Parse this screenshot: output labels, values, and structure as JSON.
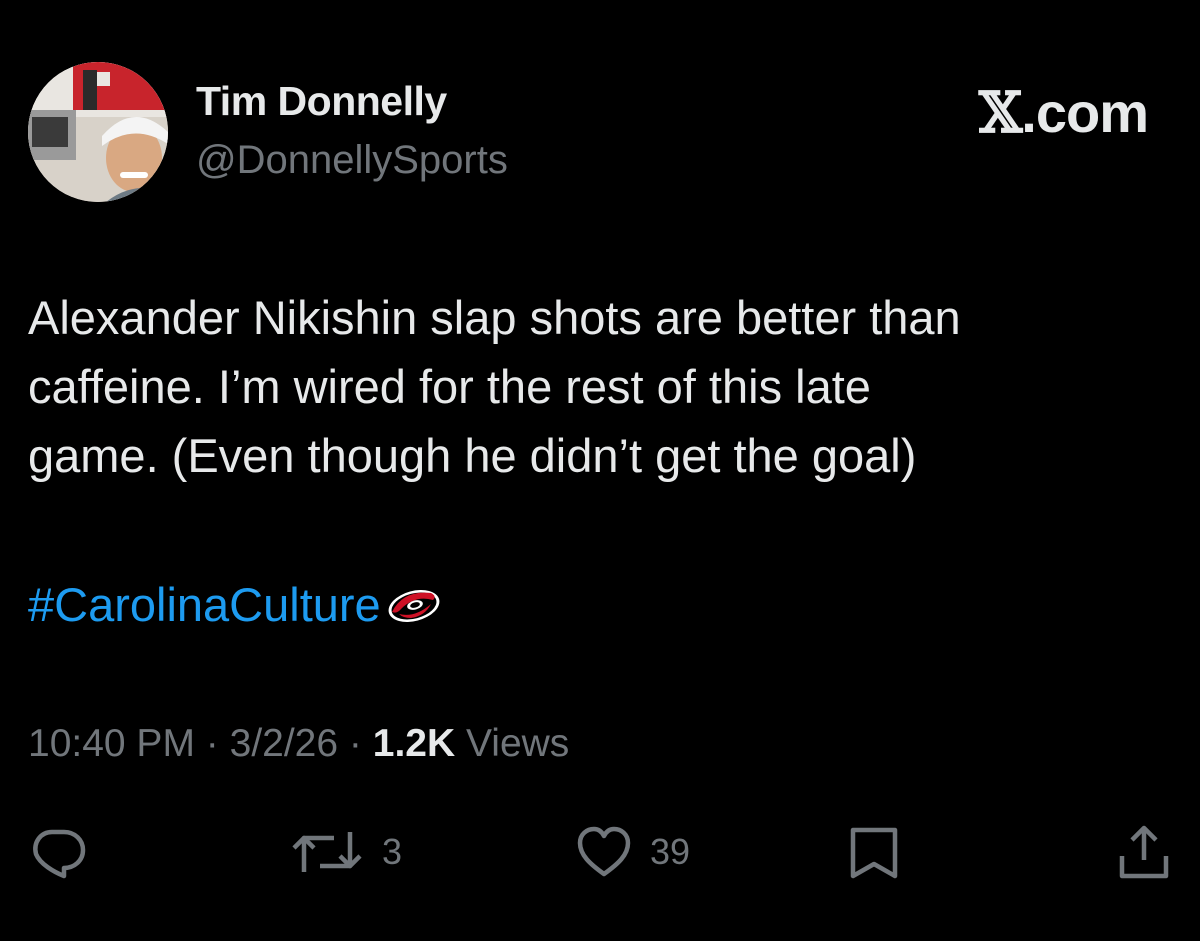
{
  "author": {
    "name": "Tim Donnelly",
    "handle": "@DonnellySports"
  },
  "brand": {
    "logo_text": ".com",
    "icon": "x-logo-icon"
  },
  "tweet": {
    "lines": [
      "Alexander Nikishin slap shots are better than",
      "caffeine.  I’m wired for the rest of this late",
      "game.  (Even though he didn’t get the goal)"
    ],
    "hashtag": "#CarolinaCulture",
    "hashtag_emoji": "carolina-hurricanes-logo-icon"
  },
  "meta": {
    "time": "10:40 PM",
    "separator": "·",
    "date": "3/2/26",
    "views_count": "1.2K",
    "views_label": "Views"
  },
  "actions": {
    "reply": {
      "icon": "reply-icon",
      "count": ""
    },
    "retweet": {
      "icon": "retweet-icon",
      "count": "3"
    },
    "like": {
      "icon": "heart-icon",
      "count": "39"
    },
    "bookmark": {
      "icon": "bookmark-icon",
      "count": ""
    },
    "share": {
      "icon": "share-icon",
      "count": ""
    }
  },
  "colors": {
    "background": "#000000",
    "text": "#e7e9ea",
    "secondary": "#71767b",
    "link": "#1d9bf0"
  }
}
